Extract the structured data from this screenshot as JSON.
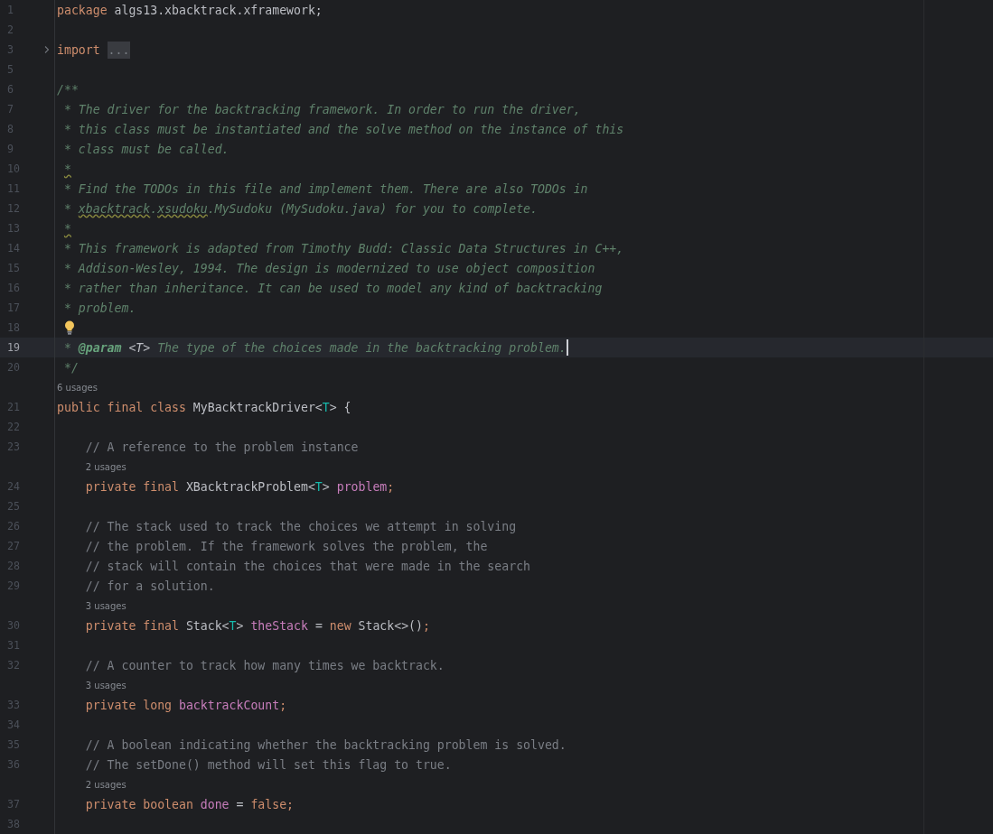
{
  "editor": {
    "lines": [
      {
        "kind": "code",
        "number": "1",
        "tokens": [
          {
            "kind": "keyword",
            "text": "package"
          },
          {
            "kind": "plain",
            "text": " algs13.xbacktrack.xframework;"
          }
        ]
      },
      {
        "kind": "code",
        "number": "2"
      },
      {
        "kind": "code",
        "number": "3",
        "foldable": true,
        "tokens": [
          {
            "kind": "keyword",
            "text": "import "
          },
          {
            "kind": "fold",
            "text": "..."
          }
        ]
      },
      {
        "kind": "code",
        "number": "5"
      },
      {
        "kind": "code",
        "number": "6",
        "tokens": [
          {
            "kind": "doc",
            "text": "/**"
          }
        ]
      },
      {
        "kind": "code",
        "number": "7",
        "tokens": [
          {
            "kind": "doc",
            "text": " * The driver for the backtracking framework. In order to run the driver,"
          }
        ]
      },
      {
        "kind": "code",
        "number": "8",
        "tokens": [
          {
            "kind": "doc",
            "text": " * this class must be instantiated and the solve method on the instance of this"
          }
        ]
      },
      {
        "kind": "code",
        "number": "9",
        "tokens": [
          {
            "kind": "doc",
            "text": " * class must be called."
          }
        ]
      },
      {
        "kind": "code",
        "number": "10",
        "tokens": [
          {
            "kind": "warning",
            "text": "*"
          }
        ]
      },
      {
        "kind": "code",
        "number": "11",
        "tokens": [
          {
            "kind": "doc",
            "text": " * Find the TODOs in this file and implement them. There are also TODOs in"
          }
        ]
      },
      {
        "kind": "code",
        "number": "12",
        "tokens": [
          {
            "kind": "doc",
            "text": " * "
          },
          {
            "kind": "warning",
            "text": "xbacktrack"
          },
          {
            "kind": "doc",
            "text": "."
          },
          {
            "kind": "warning",
            "text": "xsudoku"
          },
          {
            "kind": "doc",
            "text": ".MySudoku (MySudoku.java) for you to complete."
          }
        ]
      },
      {
        "kind": "code",
        "number": "13",
        "tokens": [
          {
            "kind": "warning",
            "text": "*"
          }
        ]
      },
      {
        "kind": "code",
        "number": "14",
        "tokens": [
          {
            "kind": "doc",
            "text": " * This framework is adapted from Timothy Budd: Classic Data Structures in C++,"
          }
        ]
      },
      {
        "kind": "code",
        "number": "15",
        "tokens": [
          {
            "kind": "doc",
            "text": " * Addison-Wesley, 1994. The design is modernized to use object composition"
          }
        ]
      },
      {
        "kind": "code",
        "number": "16",
        "tokens": [
          {
            "kind": "doc",
            "text": " * rather than inheritance. It can be used to model any kind of backtracking"
          }
        ]
      },
      {
        "kind": "code",
        "number": "17",
        "tokens": [
          {
            "kind": "doc",
            "text": " * problem."
          }
        ]
      },
      {
        "kind": "code",
        "number": "18",
        "bulb": true
      },
      {
        "kind": "code",
        "number": "19",
        "current": true,
        "tokens": [
          {
            "kind": "doc",
            "text": " * "
          },
          {
            "kind": "doctag",
            "text": "@param "
          },
          {
            "kind": "docparam",
            "text": "<T>"
          },
          {
            "kind": "doc",
            "text": " The type of the choices made in the backtracking problem."
          }
        ]
      },
      {
        "kind": "code",
        "number": "20",
        "tokens": [
          {
            "kind": "doc",
            "text": " */"
          }
        ]
      },
      {
        "kind": "hint",
        "text": "6 usages"
      },
      {
        "kind": "code",
        "number": "21",
        "tokens": [
          {
            "kind": "keyword",
            "text": "public final class "
          },
          {
            "kind": "plain",
            "text": "MyBacktrackDriver<"
          },
          {
            "kind": "typeparam",
            "text": "T"
          },
          {
            "kind": "plain",
            "text": "> {"
          }
        ]
      },
      {
        "kind": "code",
        "number": "22"
      },
      {
        "kind": "code",
        "number": "23",
        "tokens": [
          {
            "kind": "comment",
            "text": "    // A reference to the problem instance"
          }
        ]
      },
      {
        "kind": "hint",
        "text": "2 usages"
      },
      {
        "kind": "code",
        "number": "24",
        "tokens": [
          {
            "kind": "keyword",
            "text": "    private final "
          },
          {
            "kind": "plain",
            "text": "XBacktrackProblem<"
          },
          {
            "kind": "typeparam",
            "text": "T"
          },
          {
            "kind": "plain",
            "text": "> "
          },
          {
            "kind": "field",
            "text": "problem"
          },
          {
            "kind": "keyword",
            "text": ";"
          }
        ]
      },
      {
        "kind": "code",
        "number": "25"
      },
      {
        "kind": "code",
        "number": "26",
        "tokens": [
          {
            "kind": "comment",
            "text": "    // The stack used to track the choices we attempt in solving"
          }
        ]
      },
      {
        "kind": "code",
        "number": "27",
        "tokens": [
          {
            "kind": "comment",
            "text": "    // the problem. If the framework solves the problem, the"
          }
        ]
      },
      {
        "kind": "code",
        "number": "28",
        "tokens": [
          {
            "kind": "comment",
            "text": "    // stack will contain the choices that were made in the search"
          }
        ]
      },
      {
        "kind": "code",
        "number": "29",
        "tokens": [
          {
            "kind": "comment",
            "text": "    // for a solution."
          }
        ]
      },
      {
        "kind": "hint",
        "text": "3 usages"
      },
      {
        "kind": "code",
        "number": "30",
        "tokens": [
          {
            "kind": "keyword",
            "text": "    private final "
          },
          {
            "kind": "plain",
            "text": "Stack<"
          },
          {
            "kind": "typeparam",
            "text": "T"
          },
          {
            "kind": "plain",
            "text": "> "
          },
          {
            "kind": "field",
            "text": "theStack"
          },
          {
            "kind": "plain",
            "text": " = "
          },
          {
            "kind": "keyword",
            "text": "new "
          },
          {
            "kind": "plain",
            "text": "Stack<>()"
          },
          {
            "kind": "keyword",
            "text": ";"
          }
        ]
      },
      {
        "kind": "code",
        "number": "31"
      },
      {
        "kind": "code",
        "number": "32",
        "tokens": [
          {
            "kind": "comment",
            "text": "    // A counter to track how many times we backtrack."
          }
        ]
      },
      {
        "kind": "hint",
        "text": "3 usages"
      },
      {
        "kind": "code",
        "number": "33",
        "tokens": [
          {
            "kind": "keyword",
            "text": "    private long "
          },
          {
            "kind": "field",
            "text": "backtrackCount"
          },
          {
            "kind": "keyword",
            "text": ";"
          }
        ]
      },
      {
        "kind": "code",
        "number": "34"
      },
      {
        "kind": "code",
        "number": "35",
        "tokens": [
          {
            "kind": "comment",
            "text": "    // A boolean indicating whether the backtracking problem is solved."
          }
        ]
      },
      {
        "kind": "code",
        "number": "36",
        "tokens": [
          {
            "kind": "comment",
            "text": "    // The setDone() method will set this flag to true."
          }
        ]
      },
      {
        "kind": "hint",
        "text": "2 usages"
      },
      {
        "kind": "code",
        "number": "37",
        "tokens": [
          {
            "kind": "keyword",
            "text": "    private boolean "
          },
          {
            "kind": "field",
            "text": "done"
          },
          {
            "kind": "plain",
            "text": " = "
          },
          {
            "kind": "keyword",
            "text": "false;"
          }
        ]
      },
      {
        "kind": "code",
        "number": "38"
      }
    ]
  }
}
